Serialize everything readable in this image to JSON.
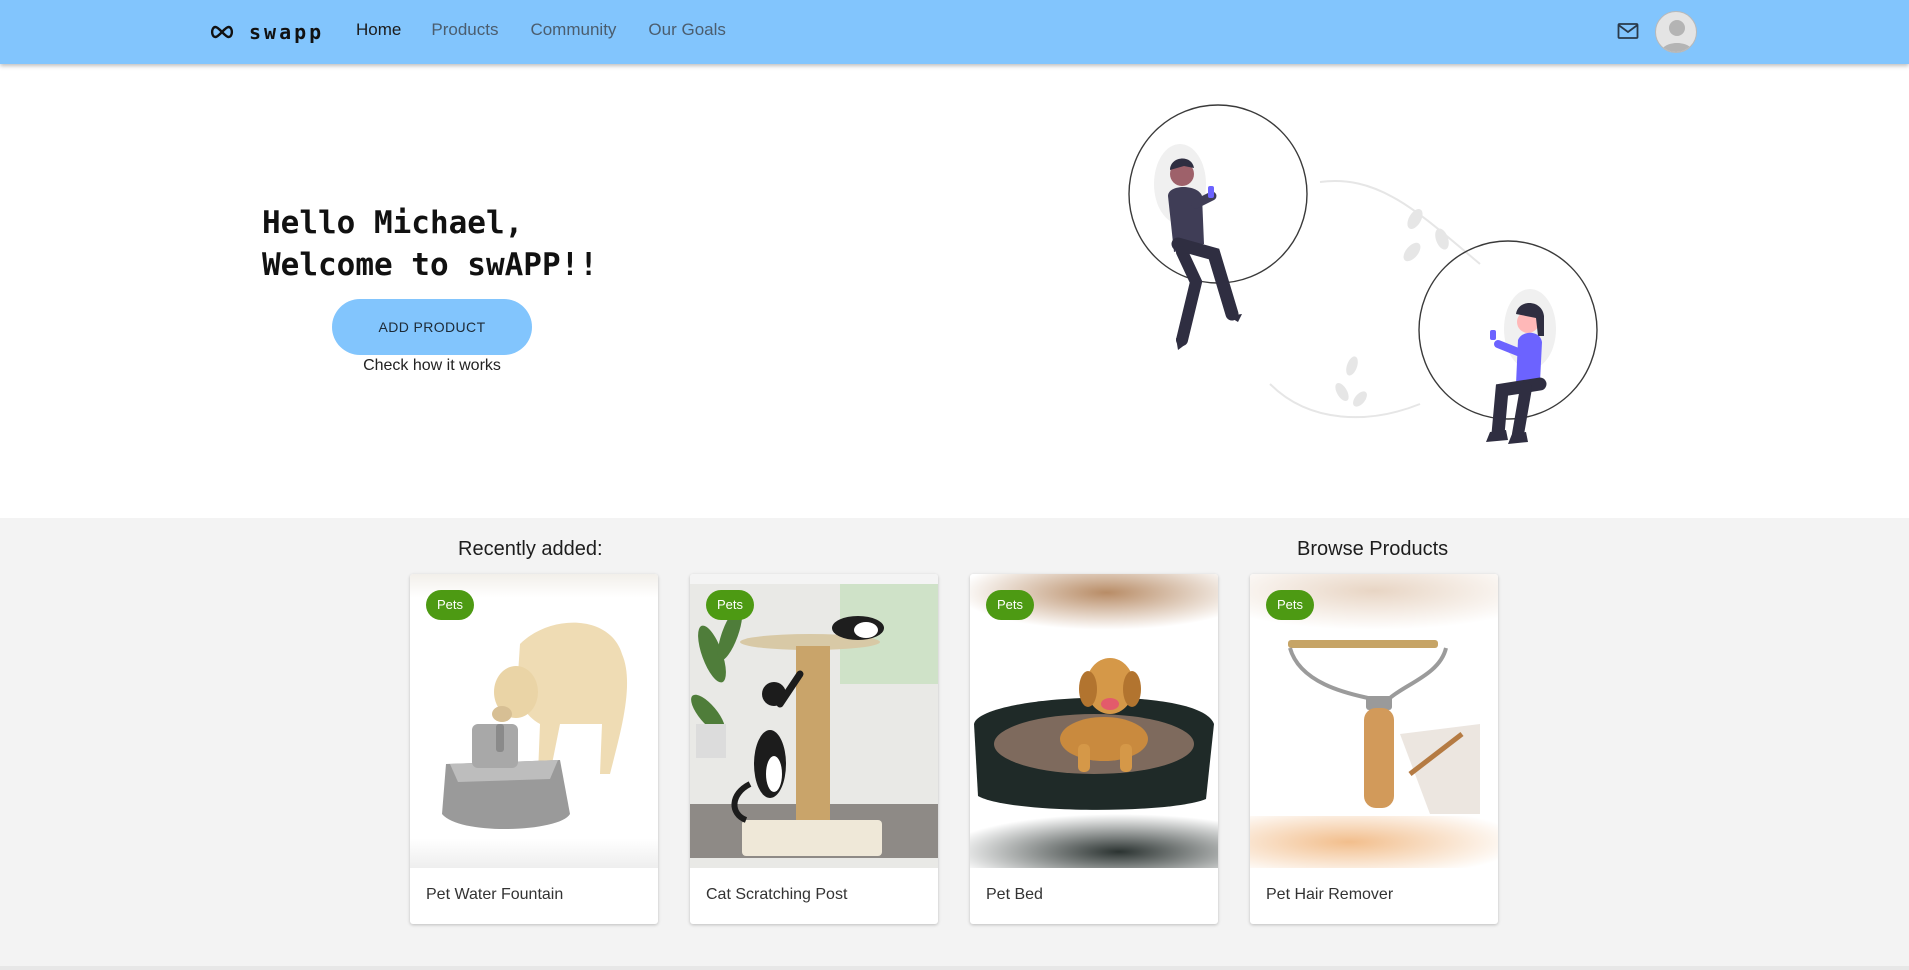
{
  "nav": {
    "brand": "swapp",
    "links": [
      "Home",
      "Products",
      "Community",
      "Our Goals"
    ],
    "active": "Home",
    "mail_icon": "mail-icon",
    "avatar_icon": "user-avatar-icon"
  },
  "hero": {
    "greeting_line1": "Hello Michael,",
    "greeting_line2": "Welcome to swAPP!!",
    "add_button": "ADD PRODUCT",
    "how_link": "Check how it works"
  },
  "products": {
    "recent_title": "Recently added:",
    "browse_title": "Browse Products",
    "items": [
      {
        "name": "Pet Water Fountain",
        "category": "Pets"
      },
      {
        "name": "Cat Scratching Post",
        "category": "Pets"
      },
      {
        "name": "Pet Bed",
        "category": "Pets"
      },
      {
        "name": "Pet Hair Remover",
        "category": "Pets"
      }
    ]
  },
  "colors": {
    "navbar": "#82c5fd",
    "chip": "#4d9a13",
    "accent_person": "#6c63ff"
  }
}
